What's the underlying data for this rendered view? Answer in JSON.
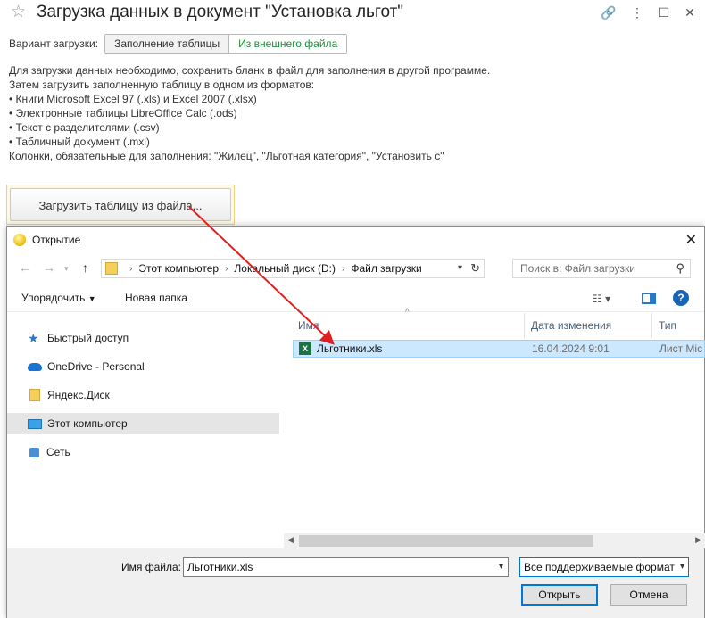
{
  "form": {
    "title": "Загрузка данных в документ \"Установка льгот\"",
    "mode_label": "Вариант загрузки:",
    "modes": [
      {
        "label": "Заполнение таблицы",
        "active": false
      },
      {
        "label": "Из внешнего файла",
        "active": true
      }
    ],
    "info_lines": [
      "Для загрузки данных необходимо, сохранить бланк в файл для заполнения в другой программе.",
      "Затем загрузить заполненную таблицу в одном из форматов:",
      "• Книги Microsoft Excel 97 (.xls) и Excel 2007 (.xlsx)",
      "• Электронные таблицы LibreOffice Calc (.ods)",
      "• Текст с разделителями (.csv)",
      "• Табличный документ (.mxl)",
      "Колонки, обязательные для заполнения: \"Жилец\", \"Льготная категория\", \"Установить с\""
    ],
    "load_button": "Загрузить таблицу из файла..."
  },
  "dialog": {
    "title": "Открытие",
    "breadcrumbs": [
      "Этот компьютер",
      "Локальный диск (D:)",
      "Файл загрузки"
    ],
    "search_placeholder": "Поиск в: Файл загрузки",
    "organize": "Упорядочить",
    "new_folder": "Новая папка",
    "nav_items": [
      {
        "label": "Быстрый доступ",
        "icon": "star-icon"
      },
      {
        "label": "OneDrive - Personal",
        "icon": "cloud-icon"
      },
      {
        "label": "Яндекс.Диск",
        "icon": "folder-icon"
      },
      {
        "label": "Этот компьютер",
        "icon": "computer-icon",
        "selected": true
      },
      {
        "label": "Сеть",
        "icon": "network-icon"
      }
    ],
    "columns": [
      "Имя",
      "Дата изменения",
      "Тип"
    ],
    "files": [
      {
        "name": "Льготники.xls",
        "date": "16.04.2024 9:01",
        "type": "Лист Mic"
      }
    ],
    "filename_label": "Имя файла:",
    "filename_value": "Льготники.xls",
    "filetype_value": "Все поддерживаемые формат",
    "open_button": "Открыть",
    "cancel_button": "Отмена"
  },
  "colors": {
    "active_mode": "#1f8f3a",
    "arrow": "#e02020",
    "selection": "#cce8ff",
    "accent": "#0078d7"
  }
}
